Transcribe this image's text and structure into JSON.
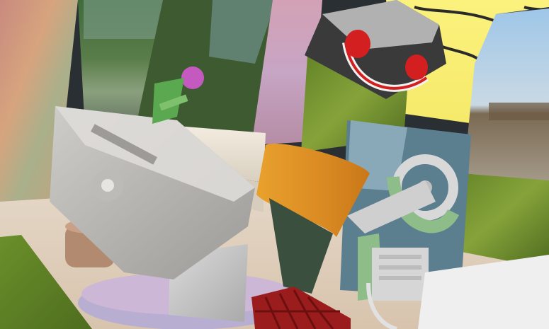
{
  "scene": {
    "kind": "rendered-3d-clutter-scene",
    "palette": {
      "sky": "#f7f07a",
      "wall_pastel": "#d9a0a8",
      "foliage": "#6f8f2e",
      "cream_box": "#f1eadc",
      "orange_cylinder": "#e39a2a",
      "gray_box": "#b9b6b1",
      "mint_parts": "#8fbd8a",
      "red_rack": "#9a1c1c",
      "headphones_red": "#d31f1f",
      "ground": "#e9e0d6"
    },
    "objects": [
      {
        "name": "pastel-wall-panel"
      },
      {
        "name": "landscape-panel-left"
      },
      {
        "name": "landscape-panel-center"
      },
      {
        "name": "sky-panel-with-scribbles"
      },
      {
        "name": "desert-landscape-panel"
      },
      {
        "name": "grass-block"
      },
      {
        "name": "toolbox"
      },
      {
        "name": "cream-box"
      },
      {
        "name": "orange-cylinder"
      },
      {
        "name": "headphones-box"
      },
      {
        "name": "motorbike-model"
      },
      {
        "name": "green-toy-figure"
      },
      {
        "name": "red-rack"
      },
      {
        "name": "round-pedestal"
      }
    ]
  }
}
